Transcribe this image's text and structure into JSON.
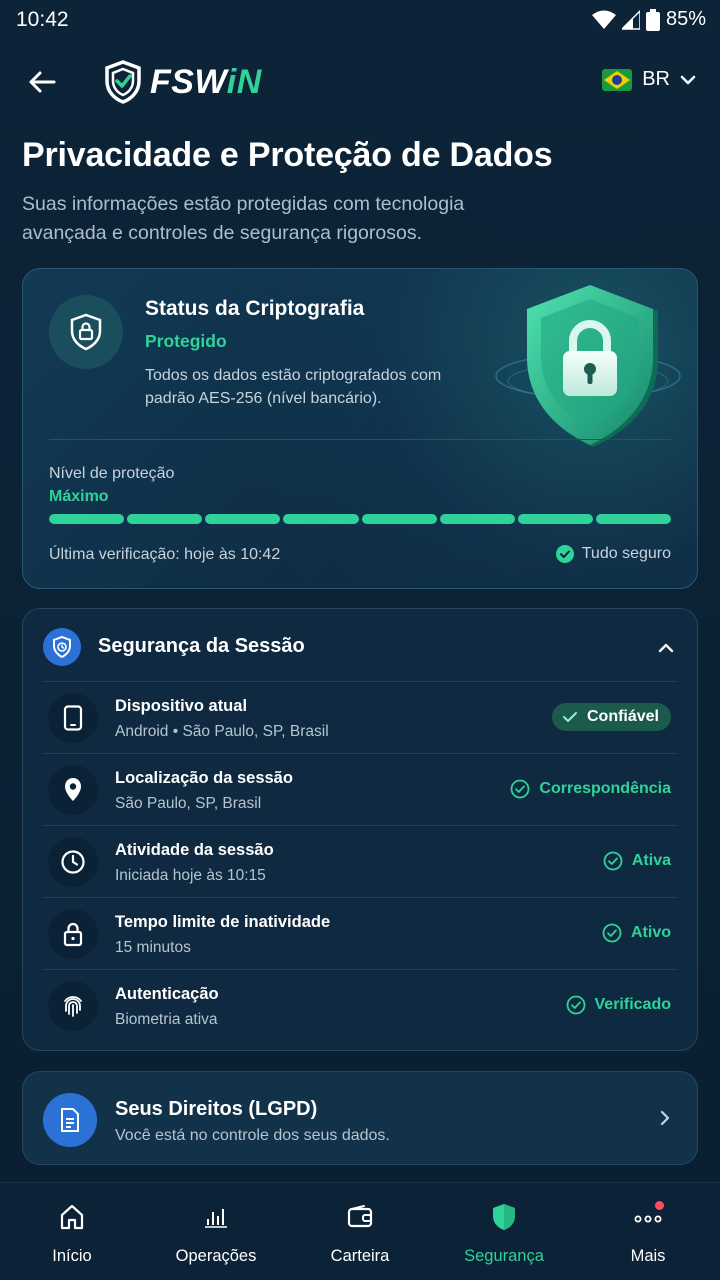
{
  "status_bar": {
    "time": "10:42",
    "battery": "85%"
  },
  "header": {
    "logo_main": "FSW",
    "logo_accent": "iN",
    "language": "BR"
  },
  "page": {
    "title": "Privacidade e Proteção de Dados",
    "subtitle": "Suas informações estão protegidas com tecnologia avançada e controles de segurança rigorosos."
  },
  "encryption": {
    "title": "Status da Criptografia",
    "status": "Protegido",
    "description": "Todos os dados estão criptografados com padrão AES-256 (nível bancário).",
    "level_label": "Nível de proteção",
    "level_value": "Máximo",
    "level_segments_filled": 8,
    "level_segments_total": 8,
    "last_check": "Última verificação: hoje às 10:42",
    "overall_status": "Tudo seguro"
  },
  "session": {
    "title": "Segurança da Sessão",
    "rows": [
      {
        "icon": "phone-icon",
        "title": "Dispositivo atual",
        "subtitle": "Android • São Paulo, SP, Brasil",
        "status": "Confiável"
      },
      {
        "icon": "location-pin-icon",
        "title": "Localização da sessão",
        "subtitle": "São Paulo, SP, Brasil",
        "status": "Correspondência"
      },
      {
        "icon": "clock-icon",
        "title": "Atividade da sessão",
        "subtitle": "Iniciada hoje às 10:15",
        "status": "Ativa"
      },
      {
        "icon": "lock-icon",
        "title": "Tempo limite de inatividade",
        "subtitle": "15 minutos",
        "status": "Ativo"
      },
      {
        "icon": "fingerprint-icon",
        "title": "Autenticação",
        "subtitle": "Biometria ativa",
        "status": "Verificado"
      }
    ]
  },
  "rights": {
    "title": "Seus Direitos (LGPD)",
    "subtitle": "Você está no controle dos seus dados."
  },
  "nav": {
    "items": [
      {
        "label": "Início",
        "icon": "home-icon"
      },
      {
        "label": "Operações",
        "icon": "chart-icon"
      },
      {
        "label": "Carteira",
        "icon": "wallet-icon"
      },
      {
        "label": "Segurança",
        "icon": "shield-icon"
      },
      {
        "label": "Mais",
        "icon": "more-icon"
      }
    ],
    "active_index": 3
  },
  "colors": {
    "accent": "#2fd39a",
    "brand_blue": "#2c72d6",
    "background": "#0d2438",
    "alert": "#ff4d5e"
  }
}
